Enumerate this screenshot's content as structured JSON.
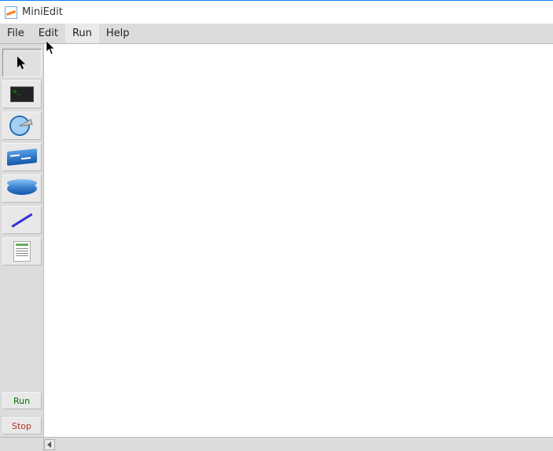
{
  "window": {
    "title": "MiniEdit"
  },
  "menus": {
    "file": "File",
    "edit": "Edit",
    "run": "Run",
    "help": "Help"
  },
  "tools": {
    "select": "select-tool",
    "host": "host-tool",
    "legacy_router": "legacy-router-tool",
    "switch": "switch-tool",
    "router": "router-tool",
    "link": "link-tool",
    "controller": "controller-tool"
  },
  "actions": {
    "run": "Run",
    "stop": "Stop"
  }
}
